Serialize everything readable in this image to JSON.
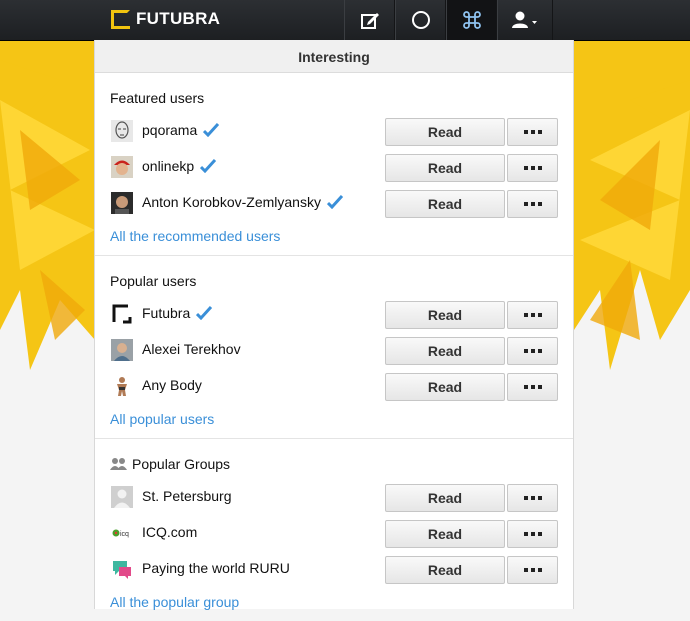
{
  "app": {
    "brand": "FUTUBRA",
    "nav": [
      {
        "icon": "compose-icon"
      },
      {
        "icon": "circle-icon"
      },
      {
        "icon": "command-icon",
        "active": true
      },
      {
        "icon": "user-menu-icon"
      }
    ]
  },
  "page": {
    "title": "Interesting"
  },
  "colors": {
    "accent_link": "#3a8fd8",
    "brand_yellow": "#f2c40f",
    "verified": "#3a8fd8"
  },
  "sections": [
    {
      "title": "Featured users",
      "items": [
        {
          "name": "pqorama",
          "verified": true,
          "avatar_icon": "sketch-face-avatar"
        },
        {
          "name": "onlinekp",
          "verified": true,
          "avatar_icon": "red-cap-avatar"
        },
        {
          "name": "Anton Korobkov-Zemlyansky",
          "verified": true,
          "avatar_icon": "photo-avatar"
        }
      ],
      "link": "All the recommended users"
    },
    {
      "title": "Popular users",
      "items": [
        {
          "name": "Futubra",
          "verified": true,
          "avatar_icon": "futubra-logo-avatar"
        },
        {
          "name": "Alexei Terekhov",
          "verified": false,
          "avatar_icon": "photo-avatar"
        },
        {
          "name": "Any Body",
          "verified": false,
          "avatar_icon": "figure-avatar"
        }
      ],
      "link": "All popular users"
    },
    {
      "title": "Popular Groups",
      "title_icon": "group-icon",
      "items": [
        {
          "name": "St. Petersburg",
          "verified": false,
          "avatar_icon": "placeholder-avatar"
        },
        {
          "name": "ICQ.com",
          "verified": false,
          "avatar_icon": "icq-logo-avatar"
        },
        {
          "name": "Paying the world RURU",
          "verified": false,
          "avatar_icon": "chat-bubble-avatar"
        }
      ],
      "link": "All the popular group"
    }
  ],
  "buttons": {
    "read_label": "Read"
  }
}
